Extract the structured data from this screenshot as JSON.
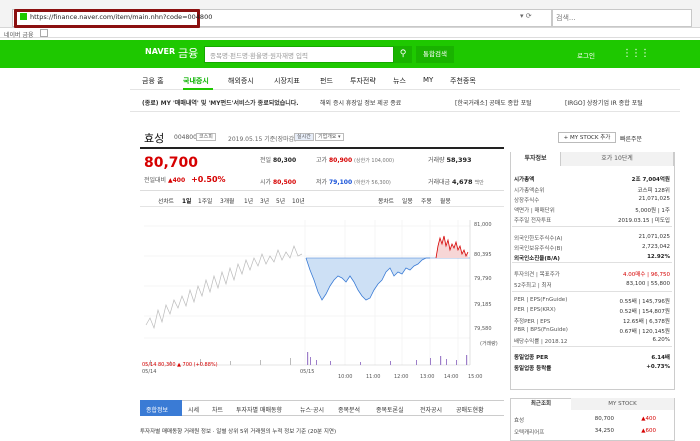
{
  "browser": {
    "url": "https://finance.naver.com/item/main.nhn?code=004800",
    "search_placeholder": "검색...",
    "tab_title": "네이버 금융"
  },
  "header": {
    "brand": "NAVER",
    "section": "금융",
    "search_placeholder": "종목명·펀드명·환율명·원자재명 입력",
    "search_btn": "통합검색",
    "login": "로그인"
  },
  "nav": {
    "items": [
      "금융 홈",
      "국내증시",
      "해외증시",
      "시장지표",
      "펀드",
      "투자전략",
      "뉴스",
      "MY",
      "주천종목"
    ]
  },
  "news": [
    {
      "text": "(종료) MY '매매내역' 및 'MY펀드'서비스가 종료되었습니다.",
      "bold": true
    },
    {
      "text": "해외 증시 휴장일 정보 제공 종료",
      "bold": false
    },
    {
      "text": "[한국거래소] 공매도 종합 포털",
      "bold": false
    },
    {
      "text": "[IRGO] 상장기업 IR 종합 포털",
      "bold": false
    }
  ],
  "stock": {
    "name": "효성",
    "code": "004800",
    "market": "코스피",
    "date": "2019.05.15 기준(장마감)",
    "chip1": "실시간",
    "chip2": "기업개요 ▾",
    "my_stock": "+ MY STOCK 추가",
    "feedback": "빠른주문",
    "price": "80,700",
    "change_label": "전일대비",
    "change": "▲400",
    "change_pct": "+0.50%",
    "prev_label": "전일",
    "prev": "80,300",
    "high_label": "고가",
    "high": "80,900",
    "high_limit": "(상한가 104,000)",
    "volume_label": "거래량",
    "volume": "58,393",
    "open_label": "시가",
    "open": "80,500",
    "low_label": "저가",
    "low": "79,100",
    "low_limit": "(하한가 56,300)",
    "amount_label": "거래대금",
    "amount": "4,678",
    "amount_unit": "백만"
  },
  "period_tabs": [
    "선차트",
    "1일",
    "1주일",
    "3개월",
    "1년",
    "3년",
    "5년",
    "10년"
  ],
  "chart_tabs": [
    "봉차트",
    "일봉",
    "주봉",
    "월봉"
  ],
  "chart": {
    "y_ticks": [
      "81,000",
      "80,395",
      "79,790",
      "79,185",
      "79,580"
    ],
    "x_ticks": [
      "05/14",
      "05/15",
      "10:00",
      "11:00",
      "12:00",
      "13:00",
      "14:00",
      "15:00"
    ],
    "unit": "(거래량)",
    "bottom_note": "05/14  80,300  ▲ 700 (+0.88%)"
  },
  "bottom_tabs": [
    "종합정보",
    "시세",
    "차트",
    "투자자별 매매동향",
    "뉴스·공시",
    "종목분석",
    "종목토론실",
    "전자공시",
    "공매도현황"
  ],
  "trade_line": "투자자별 매매동향   거래원 정보 · 일별 상위 5위 거래원의 누적 정보 기준 (20분 지연)",
  "side": {
    "tabs": [
      "투자정보",
      "호가 10단계"
    ],
    "rows": [
      {
        "k": "시가총액",
        "v": "2조 7,004억원",
        "bold": true,
        "red": false
      },
      {
        "k": "시가총액순위",
        "v": "코스피 128위",
        "bold": false,
        "red": false
      },
      {
        "k": "상장주식수",
        "v": "21,071,025",
        "bold": false,
        "red": false
      },
      {
        "k": "액면가 | 매매단위",
        "v": "5,000원 | 1주",
        "bold": false,
        "red": false
      },
      {
        "k": "주주일  전자투표",
        "v": "2019.03.15 | 미도입",
        "bold": false,
        "red": false
      },
      {
        "k": "외국인한도주식수(A)",
        "v": "21,071,025",
        "bold": false,
        "red": false
      },
      {
        "k": "외국인보유주식수(B)",
        "v": "2,723,042",
        "bold": false,
        "red": false
      },
      {
        "k": "외국인소진율(B/A)",
        "v": "12.92%",
        "bold": true,
        "red": false
      },
      {
        "k": "투자의견 | 목표주가",
        "v": "4.00매수 | 96,750",
        "bold": false,
        "red": true
      },
      {
        "k": "52주최고 | 최저",
        "v": "83,100 | 55,800",
        "bold": false,
        "red": false
      },
      {
        "k": "PER | EPS(FnGuide)",
        "v": "0.55배 | 145,796원",
        "bold": false,
        "red": false
      },
      {
        "k": "PER | EPS(KRX)",
        "v": "0.52배 | 154,807원",
        "bold": false,
        "red": false
      },
      {
        "k": "추정PER | EPS",
        "v": "12.65배 | 6,378원",
        "bold": false,
        "red": false
      },
      {
        "k": "PBR | BPS(FnGuide)",
        "v": "0.67배 | 120,145원",
        "bold": false,
        "red": false
      },
      {
        "k": "배당수익률 | 2018.12",
        "v": "6.20%",
        "bold": false,
        "red": false
      },
      {
        "k": "동일업종 PER",
        "v": "6.14배",
        "bold": true,
        "red": false
      },
      {
        "k": "동일업종 등락률",
        "v": "+0.73%",
        "bold": true,
        "red": true
      }
    ],
    "tabs2": [
      "최근조회",
      "MY STOCK"
    ],
    "recent": [
      {
        "name": "효성",
        "price": "80,700",
        "chg": "▲400"
      },
      {
        "name": "오텍캐리어프",
        "price": "34,250",
        "chg": "▲600"
      }
    ]
  }
}
